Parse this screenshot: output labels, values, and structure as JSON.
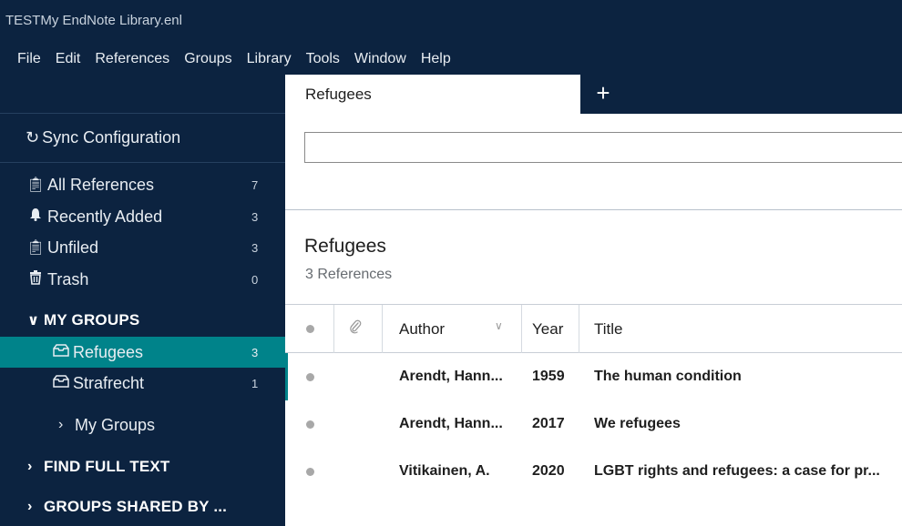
{
  "window": {
    "title": "TESTMy EndNote Library.enl"
  },
  "menu": [
    "File",
    "Edit",
    "References",
    "Groups",
    "Library",
    "Tools",
    "Window",
    "Help"
  ],
  "sidebar": {
    "sync_label": "Sync Configuration",
    "library": [
      {
        "label": "All References",
        "count": "7",
        "icon": "clipboard-icon"
      },
      {
        "label": "Recently Added",
        "count": "3",
        "icon": "bell-icon"
      },
      {
        "label": "Unfiled",
        "count": "3",
        "icon": "clipboard-icon"
      },
      {
        "label": "Trash",
        "count": "0",
        "icon": "trash-icon"
      }
    ],
    "my_groups_header": "MY GROUPS",
    "groups": [
      {
        "label": "Refugees",
        "count": "3",
        "icon": "group-icon",
        "selected": true
      },
      {
        "label": "Strafrecht",
        "count": "1",
        "icon": "group-icon",
        "selected": false
      }
    ],
    "my_groups_sub": "My Groups",
    "find_full_text": "FIND FULL TEXT",
    "groups_shared": "GROUPS SHARED BY ..."
  },
  "tabs": {
    "active": "Refugees",
    "add": "+"
  },
  "search": {
    "value": "",
    "placeholder": ""
  },
  "group": {
    "title": "Refugees",
    "count_text": "3 References"
  },
  "table": {
    "columns": {
      "author": "Author",
      "year": "Year",
      "title": "Title"
    },
    "rows": [
      {
        "author": "Arendt, Hann...",
        "year": "1959",
        "title": "The human condition"
      },
      {
        "author": "Arendt, Hann...",
        "year": "2017",
        "title": "We refugees"
      },
      {
        "author": "Vitikainen, A.",
        "year": "2020",
        "title": "LGBT rights and refugees: a case for pr..."
      }
    ]
  },
  "colors": {
    "navy": "#0c2340",
    "teal": "#00838a"
  }
}
